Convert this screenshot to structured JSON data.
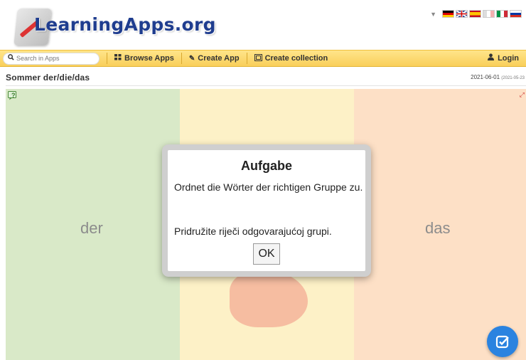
{
  "header": {
    "logo_text": "LearningApps.org",
    "language_flags": [
      "de",
      "en",
      "es",
      "fr",
      "it",
      "ru"
    ]
  },
  "nav": {
    "search_placeholder": "Search in Apps",
    "browse_label": "Browse Apps",
    "create_app_label": "Create App",
    "create_collection_label": "Create collection",
    "login_label": "Login"
  },
  "app": {
    "title": "Sommer der/die/das",
    "date": "2021-06-01",
    "date_small": "(2021-05-23"
  },
  "board": {
    "columns": [
      {
        "label": "der",
        "color": "#d9e9c8"
      },
      {
        "label": "",
        "color": "#fdf1c7"
      },
      {
        "label": "das",
        "color": "#fde0c6"
      }
    ]
  },
  "dialog": {
    "title": "Aufgabe",
    "text_de": "Ordnet die Wörter der richtigen Gruppe zu.",
    "text_hr": "Pridružite riječi odgovarajućoj grupi.",
    "ok_label": "OK"
  },
  "colors": {
    "navbar": "#f9cf5a",
    "logo": "#1f3d8f",
    "check_button": "#2a83e0"
  }
}
